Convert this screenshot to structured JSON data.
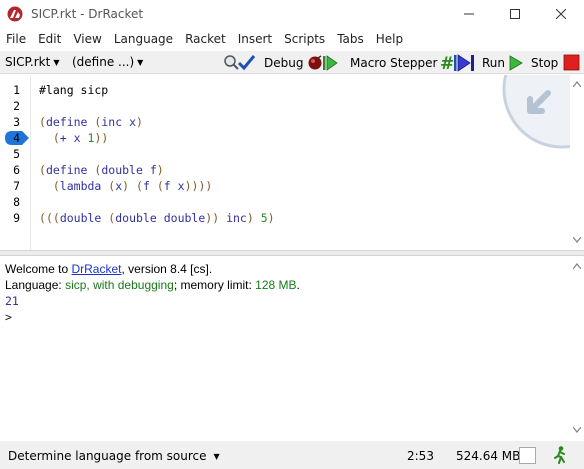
{
  "window": {
    "title": "SICP.rkt - DrRacket"
  },
  "menu": [
    "File",
    "Edit",
    "View",
    "Language",
    "Racket",
    "Insert",
    "Scripts",
    "Tabs",
    "Help"
  ],
  "toolbar": {
    "file_dropdown": "SICP.rkt",
    "define_dropdown": "(define ...)",
    "debug_label": "Debug",
    "macro_stepper_label": "Macro Stepper",
    "run_label": "Run",
    "stop_label": "Stop"
  },
  "editor": {
    "line_numbers": [
      "1",
      "2",
      "3",
      "4",
      "5",
      "6",
      "7",
      "8",
      "9"
    ],
    "active_line": "4",
    "lines": [
      "#lang sicp",
      "",
      "(define (inc x)",
      "  (+ x 1))",
      "",
      "(define (double f)",
      "  (lambda (x) (f (f x))))",
      "",
      "(((double (double double)) inc) 5)"
    ]
  },
  "interactions": {
    "welcome_prefix": "Welcome to ",
    "welcome_link": "DrRacket",
    "welcome_suffix": ", version 8.4 [cs].",
    "language_prefix": "Language: ",
    "language_name": "sicp, with debugging",
    "language_mid": "; memory limit: ",
    "memory_limit": "128 MB",
    "language_end": ".",
    "output": "21",
    "prompt": ">"
  },
  "status": {
    "language_selector": "Determine language from source",
    "position": "2:53",
    "memory": "524.64 MB"
  },
  "colors": {
    "paren": "#84592a",
    "keyword": "#3030a0",
    "number": "#2b8a1e",
    "link": "#1a33cc",
    "stop": "#e02020",
    "run": "#3db83d"
  }
}
